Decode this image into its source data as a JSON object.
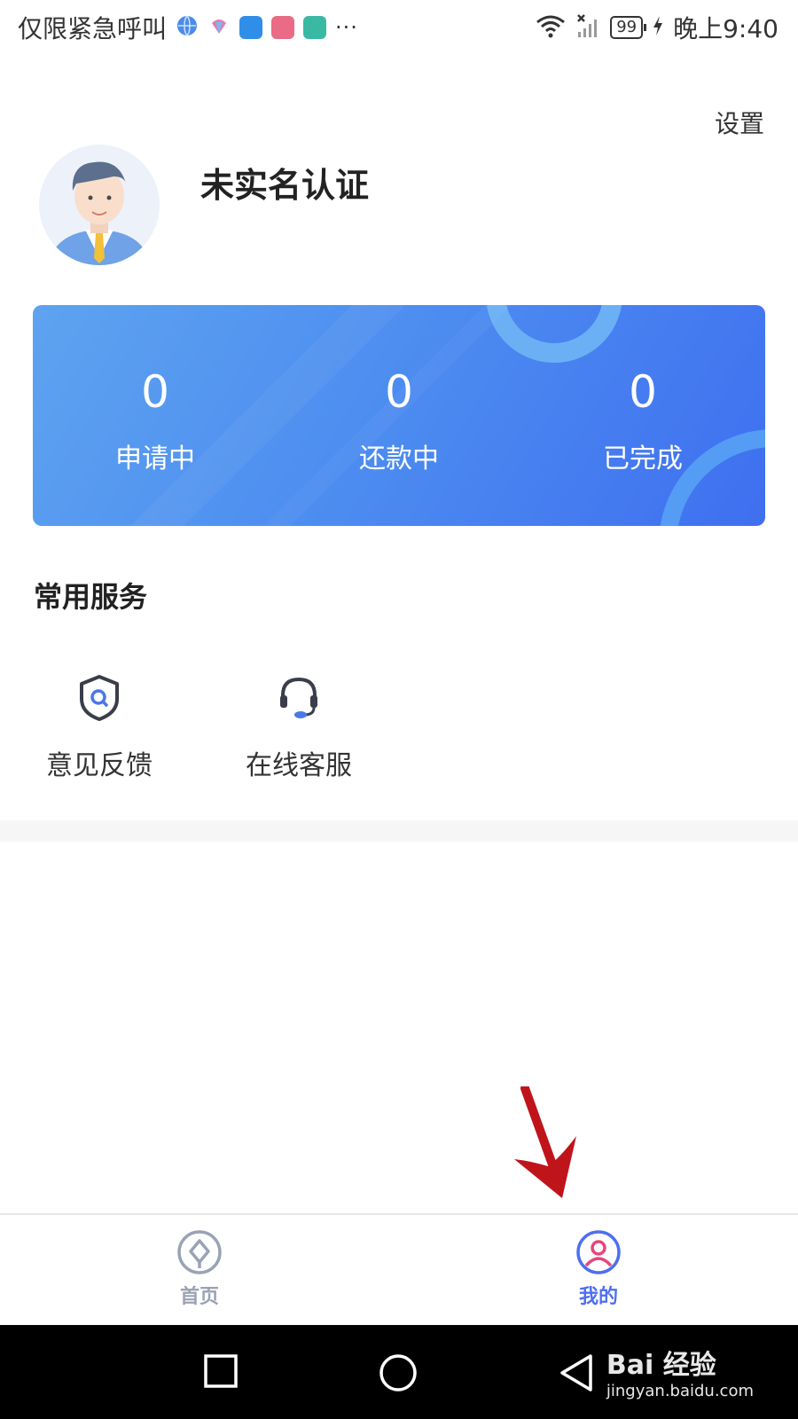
{
  "status_bar": {
    "carrier": "仅限紧急呼叫",
    "overflow": "···",
    "battery": "99",
    "time": "晚上9:40",
    "icons": [
      "browser-icon",
      "app-icon",
      "app-icon",
      "app-icon",
      "app-icon",
      "wifi-icon",
      "no-signal-icon",
      "battery-icon",
      "charging-icon"
    ]
  },
  "header": {
    "settings_label": "设置",
    "user_title": "未实名认证"
  },
  "stats": [
    {
      "value": "0",
      "label": "申请中"
    },
    {
      "value": "0",
      "label": "还款中"
    },
    {
      "value": "0",
      "label": "已完成"
    }
  ],
  "services": {
    "title": "常用服务",
    "items": [
      {
        "label": "意见反馈",
        "icon": "shield-search-icon"
      },
      {
        "label": "在线客服",
        "icon": "headset-icon"
      }
    ]
  },
  "tabbar": {
    "items": [
      {
        "label": "首页",
        "icon": "home-diamond-icon",
        "active": false
      },
      {
        "label": "我的",
        "icon": "profile-icon",
        "active": true
      }
    ]
  },
  "watermark": {
    "brand": "Bai 经验",
    "url": "jingyan.baidu.com"
  },
  "colors": {
    "card_start": "#5ea3f0",
    "card_end": "#3f6ff0",
    "tab_active": "#4d6ff0",
    "tab_inactive": "#9aa3b5",
    "arrow": "#c0141b"
  }
}
